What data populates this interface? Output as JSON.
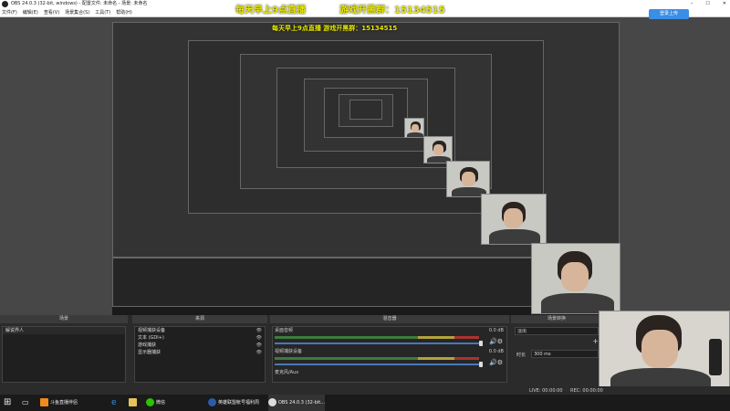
{
  "window": {
    "title": "OBS 24.0.3 (32-bit, windows) - 配置文件: 未命名 - 场景: 未命名",
    "minimize": "–",
    "maximize": "☐",
    "close": "✕"
  },
  "menu": [
    "文件(F)",
    "编辑(E)",
    "查看(V)",
    "场景集合(S)",
    "工具(T)",
    "帮助(H)"
  ],
  "overlay": {
    "line1": "每天早上9点直播",
    "line2": "游戏开黑群：15134515"
  },
  "login_button": "登录上传",
  "docks": {
    "scenes": {
      "title": "场景",
      "items": [
        "解说界人"
      ]
    },
    "sources": {
      "title": "来源",
      "items": [
        "视频捕获设备",
        "文本 (GDI+)",
        "游戏捕获",
        "显示器捕获"
      ]
    },
    "mixer": {
      "title": "混音器",
      "channels": [
        {
          "name": "桌面音频",
          "db": "0.0 dB"
        },
        {
          "name": "视频捕获设备",
          "db": "0.0 dB"
        },
        {
          "name": "麦克风/Aux",
          "db": ""
        }
      ]
    },
    "transitions": {
      "title": "场景转换",
      "type": "淡出",
      "duration_label": "时长",
      "duration_value": "300 ms"
    }
  },
  "status": {
    "live": "LIVE: 00:00:00",
    "rec": "REC: 00:00:00"
  },
  "taskbar": {
    "items": [
      "斗鱼直播伴侣",
      "微信",
      "英雄联盟帐号福利周",
      "OBS 24.0.3 (32-bit..."
    ]
  }
}
